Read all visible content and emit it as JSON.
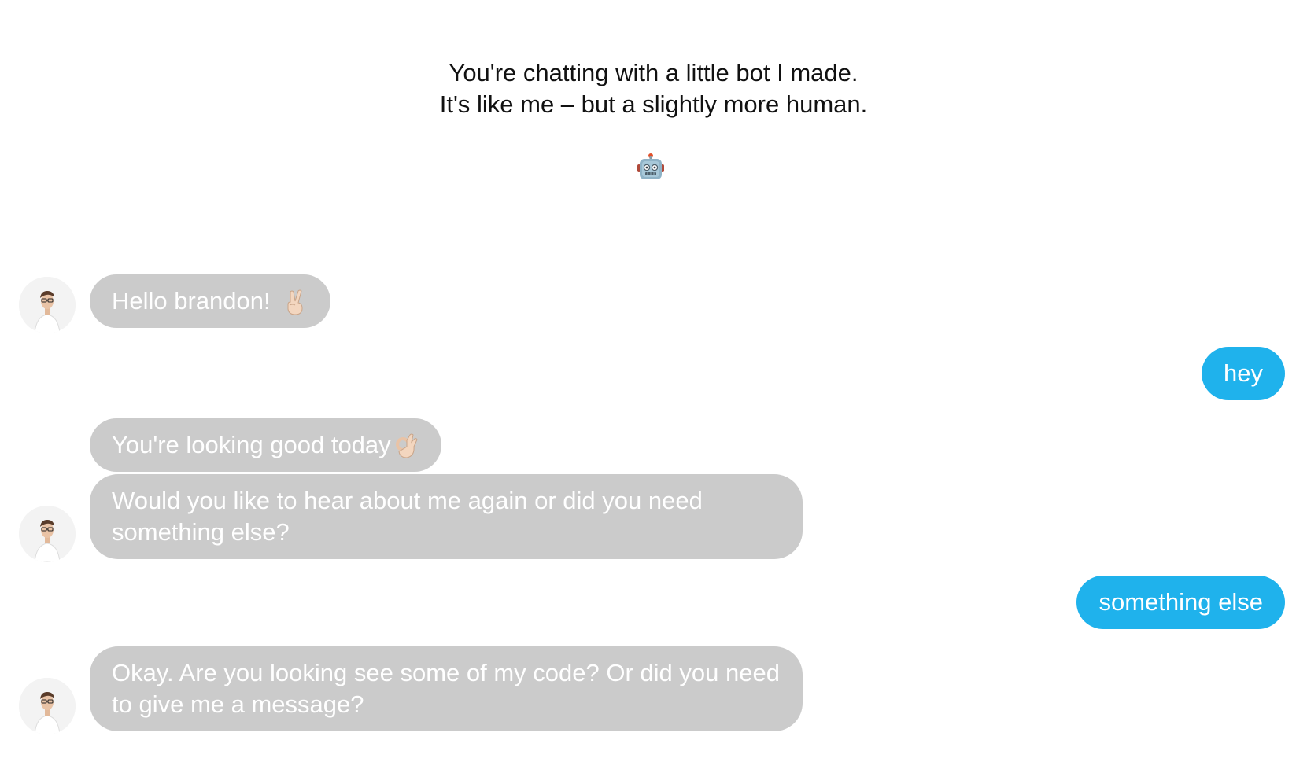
{
  "intro": {
    "line1": "You're chatting with a little bot I made.",
    "line2": "It's like me – but a slightly more human.",
    "icon": "robot-emoji"
  },
  "colors": {
    "bot_bubble": "#cbcbcb",
    "user_bubble": "#1fb2ec",
    "text_on_bubble": "#ffffff"
  },
  "messages": [
    {
      "from": "bot",
      "text": "Hello brandon!",
      "emoji": "victory-hand-emoji",
      "avatar": true
    },
    {
      "from": "user",
      "text": "hey"
    },
    {
      "from": "bot",
      "text": "You're looking good today",
      "emoji": "ok-hand-emoji",
      "avatar": false
    },
    {
      "from": "bot",
      "text": "Would you like to hear about me again or did you need something else?",
      "avatar": true
    },
    {
      "from": "user",
      "text": "something else"
    },
    {
      "from": "bot",
      "text": "Okay. Are you looking see some of my code? Or did you need to give me a message?",
      "avatar": true
    }
  ]
}
